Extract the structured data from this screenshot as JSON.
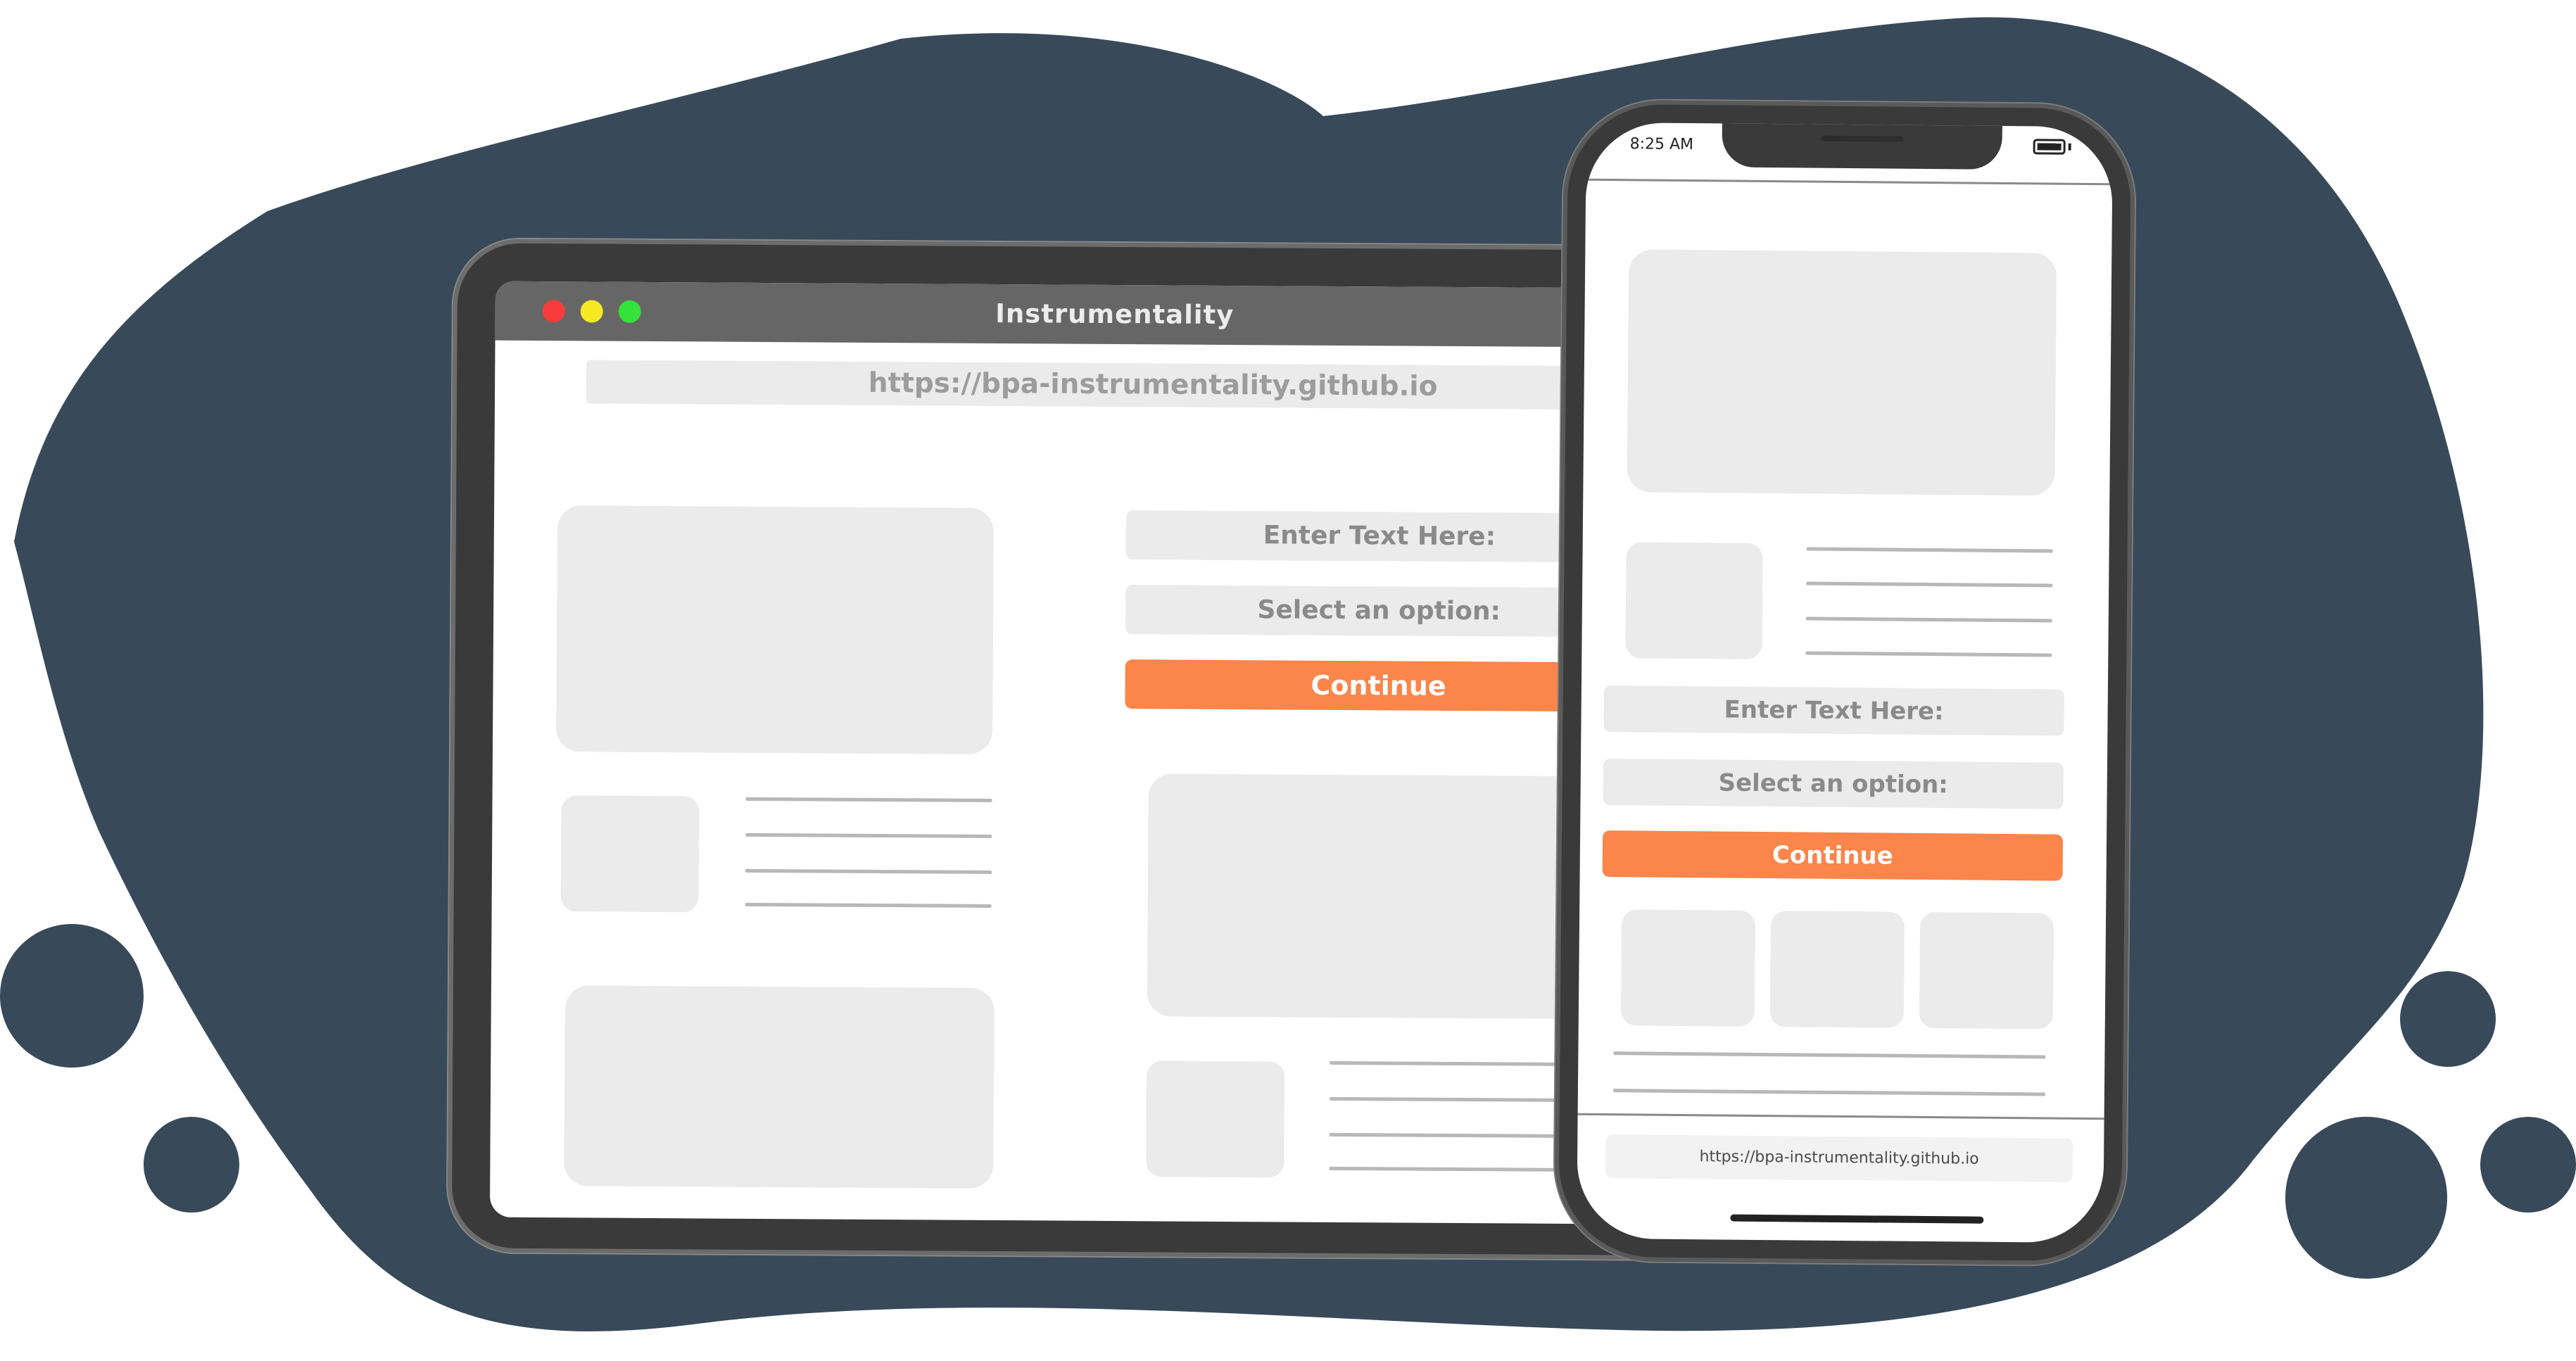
{
  "colors": {
    "background_blob": "#384a59",
    "accent": "#fb854a",
    "placeholder": "#ebebeb",
    "titlebar": "#666666",
    "window_close": "#f83b3b",
    "window_minimize": "#f5e924",
    "window_maximize": "#35e23a"
  },
  "desktop": {
    "window_title": "Instrumentality",
    "url": "https://bpa-instrumentality.github.io",
    "text_field_placeholder": "Enter Text Here:",
    "select_placeholder": "Select an option:",
    "continue_label": "Continue"
  },
  "mobile": {
    "status_time": "8:25 AM",
    "text_field_placeholder": "Enter Text Here:",
    "select_placeholder": "Select an option:",
    "continue_label": "Continue",
    "url": "https://bpa-instrumentality.github.io"
  }
}
